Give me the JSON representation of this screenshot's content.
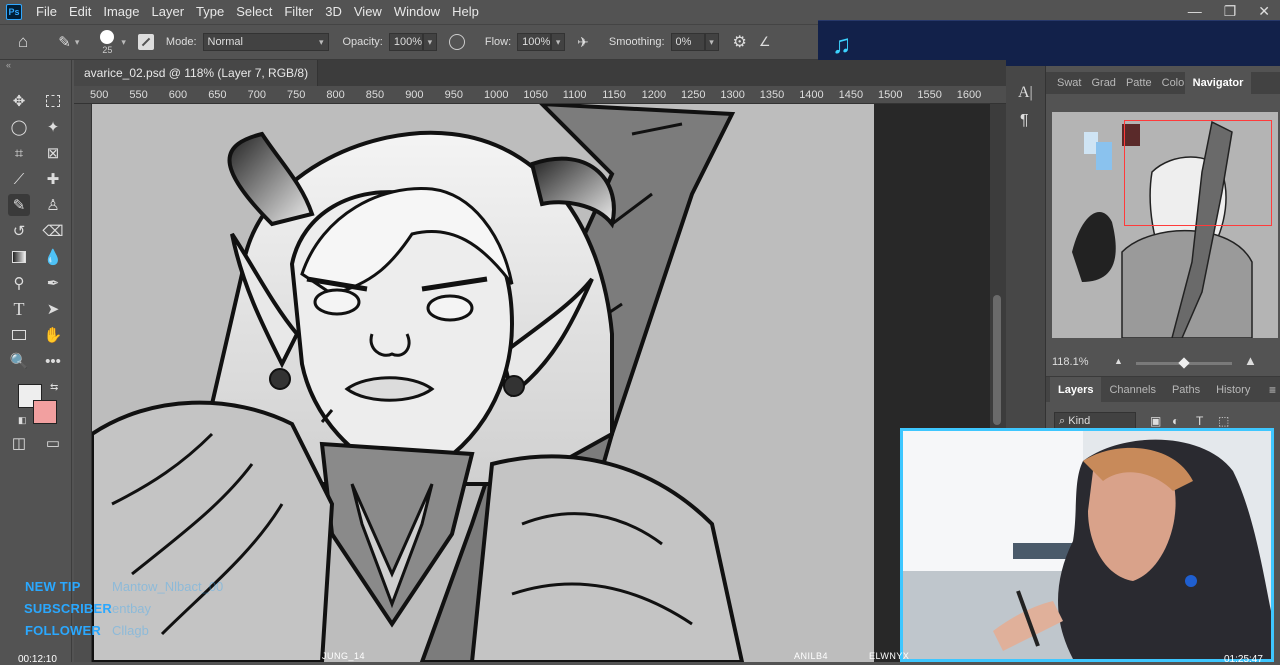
{
  "menubar": {
    "logo": "Ps",
    "items": [
      "File",
      "Edit",
      "Image",
      "Layer",
      "Type",
      "Select",
      "Filter",
      "3D",
      "View",
      "Window",
      "Help"
    ],
    "minimize": "—",
    "restore": "❐",
    "close": "✕"
  },
  "options": {
    "brush_size": "25",
    "mode_label": "Mode:",
    "mode_value": "Normal",
    "opacity_label": "Opacity:",
    "opacity_value": "100%",
    "flow_label": "Flow:",
    "flow_value": "100%",
    "smoothing_label": "Smoothing:",
    "smoothing_value": "0%"
  },
  "document": {
    "tab_title": "avarice_02.psd @ 118% (Layer 7, RGB/8)",
    "close": "×",
    "ruler_labels": [
      "500",
      "550",
      "600",
      "650",
      "700",
      "750",
      "800",
      "850",
      "900",
      "950",
      "1000",
      "1050",
      "1100",
      "1150",
      "1200",
      "1250",
      "1300",
      "1350",
      "1400",
      "1450",
      "1500",
      "1550",
      "1600"
    ]
  },
  "panels": {
    "top_tabs": [
      "Swat",
      "Grad",
      "Patte",
      "Color",
      "Navigator"
    ],
    "zoom_value": "118.1%",
    "layer_tabs": [
      "Layers",
      "Channels",
      "Paths",
      "History"
    ],
    "kind_label": "Kind"
  },
  "stream_overlay": {
    "alerts": [
      {
        "label": "NEW TIP",
        "value": "Mantow_Nlbact_00"
      },
      {
        "label": "SUBSCRIBER",
        "value": "entbay"
      },
      {
        "label": "FOLLOWER",
        "value": "Cllagb"
      }
    ],
    "timer_left": "00:12:10",
    "timer_right": "01:25:47",
    "bottom_names": [
      "JUNG_14",
      "ANILB4",
      "ELWNYX"
    ]
  },
  "colors": {
    "foreground": "#eeeeee",
    "background": "#f2a0a0",
    "accent_overlay": "#3ec7ff",
    "alert_text": "#2aa8ff"
  }
}
